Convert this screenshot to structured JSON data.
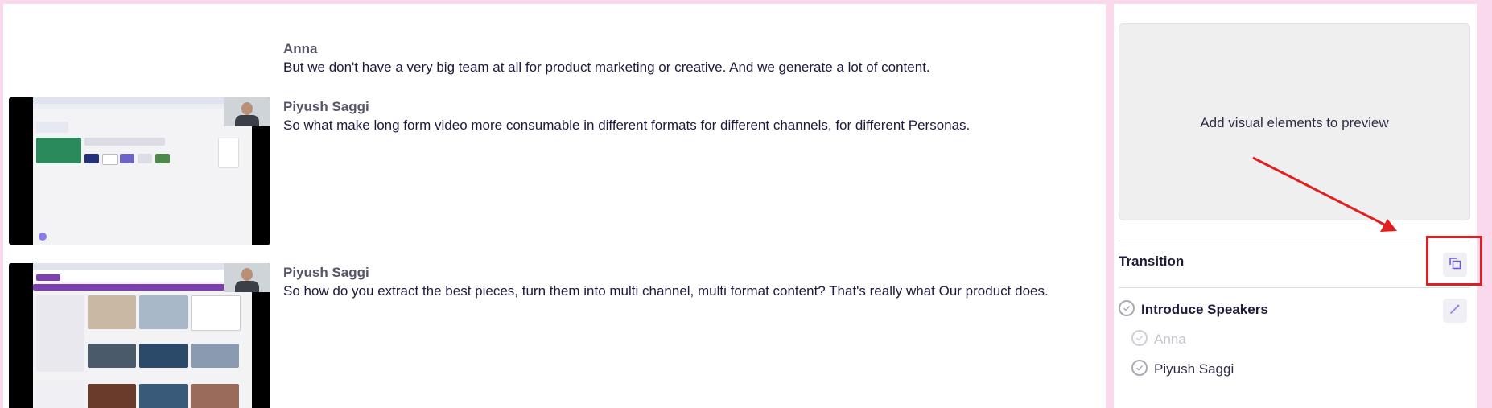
{
  "transcript": {
    "entries": [
      {
        "speaker": "Anna",
        "text": "But we don't have a very big team at all for product marketing or creative. And we generate a lot of content."
      },
      {
        "speaker": "Piyush Saggi",
        "text": "So what make long form video more consumable in different formats for different channels, for different Personas."
      },
      {
        "speaker": "Piyush Saggi",
        "text": "So how do you extract the best pieces, turn them into multi channel, multi format content? That's really what Our product does."
      }
    ]
  },
  "preview": {
    "placeholder": "Add visual elements to preview"
  },
  "transition": {
    "label": "Transition",
    "icon": "copy-layers-icon"
  },
  "steps": {
    "title": "Introduce Speakers",
    "edit_icon": "magic-wand-icon",
    "items": [
      {
        "label": "Anna",
        "state": "disabled"
      },
      {
        "label": "Piyush Saggi",
        "state": "enabled"
      }
    ]
  },
  "colors": {
    "accent": "#6b5bd6",
    "annotation": "#e02020",
    "frame": "#fbd9ec"
  }
}
